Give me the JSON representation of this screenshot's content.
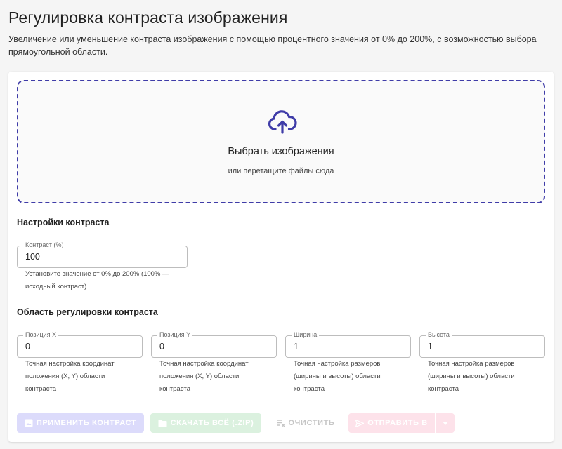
{
  "header": {
    "title": "Регулировка контраста изображения",
    "description": "Увеличение или уменьшение контраста изображения с помощью процентного значения от 0% до 200%, с возможностью выбора прямоугольной области."
  },
  "dropzone": {
    "title": "Выбрать изображения",
    "subtitle": "или перетащите файлы сюда",
    "icon": "cloud-upload-icon"
  },
  "contrast_settings": {
    "title": "Настройки контраста",
    "contrast_field": {
      "label": "Контраст (%)",
      "value": "100",
      "helper_line1": "Установите значение от 0% до 200% (100% —",
      "helper_line2": "исходный контраст)"
    }
  },
  "region": {
    "title": "Область регулировки контраста",
    "fields": [
      {
        "label": "Позиция X",
        "value": "0",
        "helper": [
          "Точная настройка координат",
          "положения (X, Y) области",
          "контраста"
        ]
      },
      {
        "label": "Позиция Y",
        "value": "0",
        "helper": [
          "Точная настройка координат",
          "положения (X, Y) области",
          "контраста"
        ]
      },
      {
        "label": "Ширина",
        "value": "1",
        "helper": [
          "Точная настройка размеров",
          "(ширины и высоты) области",
          "контраста"
        ]
      },
      {
        "label": "Высота",
        "value": "1",
        "helper": [
          "Точная настройка размеров",
          "(ширины и высоты) области",
          "контраста"
        ]
      }
    ]
  },
  "actions": {
    "apply_label": "ПРИМЕНИТЬ КОНТРАСТ",
    "download_label": "СКАЧАТЬ ВСЁ (.ZIP)",
    "clear_label": "ОЧИСТИТЬ",
    "send_label": "ОТПРАВИТЬ В"
  },
  "colors": {
    "accent": "#3f3ca8",
    "apply_disabled": "#dcdbfb",
    "download_disabled": "#dbf1df",
    "send_disabled": "#fde2ea"
  }
}
